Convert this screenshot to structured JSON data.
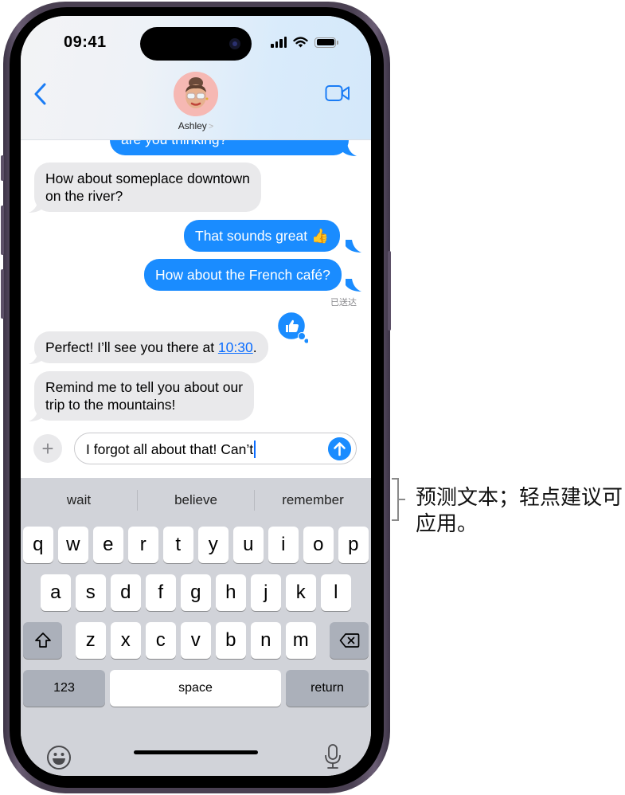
{
  "status_bar": {
    "time": "09:41",
    "signal_icon": "cellular-signal-icon",
    "wifi_icon": "wifi-icon",
    "battery_icon": "battery-full-icon"
  },
  "header": {
    "back_icon": "chevron-left-icon",
    "contact_name": "Ashley",
    "contact_chevron": ">",
    "avatar": "memoji-avatar",
    "video_icon": "video-camera-icon"
  },
  "messages": [
    {
      "direction": "out",
      "text": "are you thinking?",
      "partial": true
    },
    {
      "direction": "in",
      "lines": [
        "How about someplace downtown",
        "on the river?"
      ]
    },
    {
      "direction": "out",
      "text": "That sounds great",
      "emoji": "👍"
    },
    {
      "direction": "out",
      "text": "How about the French café?"
    },
    {
      "direction": "in",
      "text_before": "Perfect! I’ll see you there at ",
      "link": "10:30",
      "text_after": ".",
      "tapback": "thumbs-up-icon"
    },
    {
      "direction": "in",
      "lines": [
        "Remind me to tell you about our",
        "trip to the mountains!"
      ]
    }
  ],
  "delivered_label": "已送达",
  "compose": {
    "plus_icon": "plus-icon",
    "text": "I forgot all about that! Can’t",
    "send_icon": "arrow-up-icon"
  },
  "keyboard": {
    "predictions": [
      "wait",
      "believe",
      "remember"
    ],
    "row1": [
      "q",
      "w",
      "e",
      "r",
      "t",
      "y",
      "u",
      "i",
      "o",
      "p"
    ],
    "row2": [
      "a",
      "s",
      "d",
      "f",
      "g",
      "h",
      "j",
      "k",
      "l"
    ],
    "row3": [
      "z",
      "x",
      "c",
      "v",
      "b",
      "n",
      "m"
    ],
    "shift_icon": "shift-icon",
    "delete_icon": "delete-backspace-icon",
    "numbers_label": "123",
    "space_label": "space",
    "return_label": "return",
    "emoji_icon": "emoji-smile-icon",
    "mic_icon": "microphone-icon"
  },
  "annotation": {
    "text": "预测文本；轻点建议可应用。"
  },
  "colors": {
    "accent_blue": "#1a8cff",
    "incoming_bubble": "#e9e9eb",
    "keyboard_bg": "#d1d3d9",
    "key_dark": "#abb0ba"
  }
}
